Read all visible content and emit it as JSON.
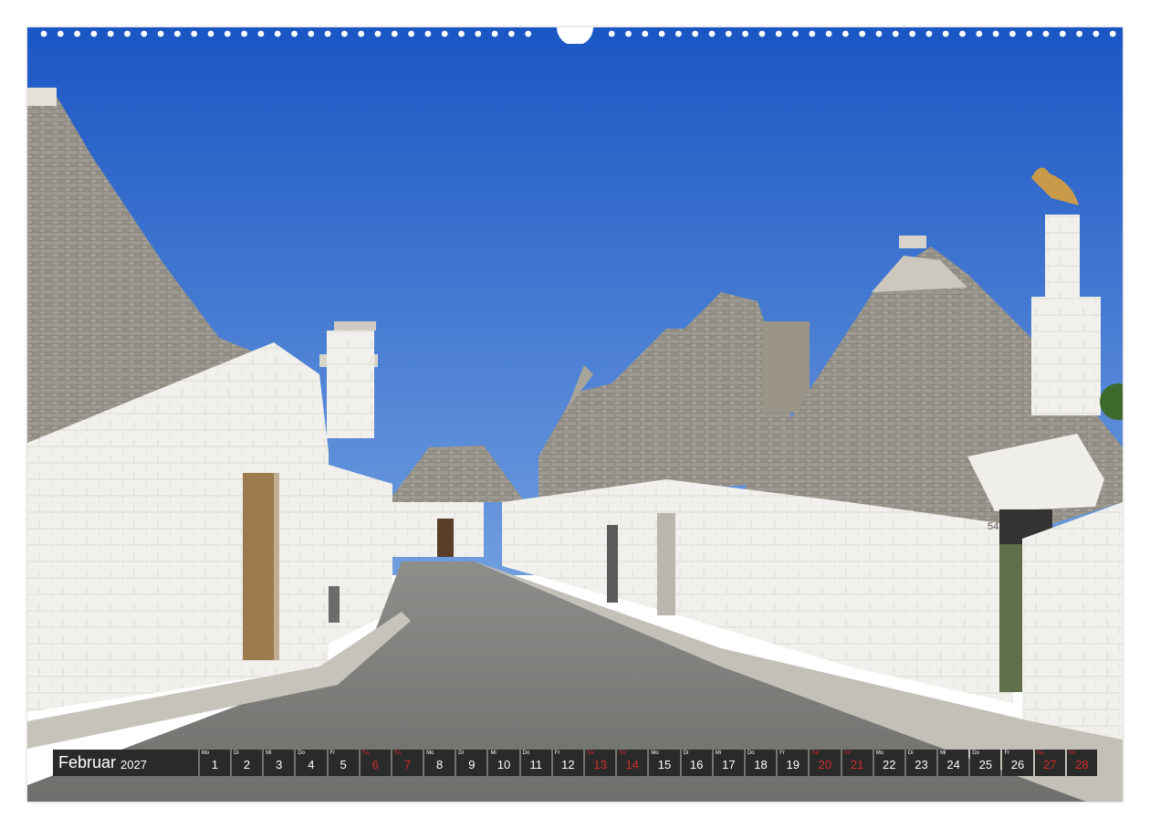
{
  "calendar": {
    "month": "Februar",
    "year": "2027",
    "days": [
      {
        "wd": "Mo",
        "d": "1",
        "weekend": false
      },
      {
        "wd": "Di",
        "d": "2",
        "weekend": false
      },
      {
        "wd": "Mi",
        "d": "3",
        "weekend": false
      },
      {
        "wd": "Do",
        "d": "4",
        "weekend": false
      },
      {
        "wd": "Fr",
        "d": "5",
        "weekend": false
      },
      {
        "wd": "Sa",
        "d": "6",
        "weekend": true
      },
      {
        "wd": "So",
        "d": "7",
        "weekend": true
      },
      {
        "wd": "Mo",
        "d": "8",
        "weekend": false
      },
      {
        "wd": "Di",
        "d": "9",
        "weekend": false
      },
      {
        "wd": "Mi",
        "d": "10",
        "weekend": false
      },
      {
        "wd": "Do",
        "d": "11",
        "weekend": false
      },
      {
        "wd": "Fr",
        "d": "12",
        "weekend": false
      },
      {
        "wd": "Sa",
        "d": "13",
        "weekend": true
      },
      {
        "wd": "So",
        "d": "14",
        "weekend": true
      },
      {
        "wd": "Mo",
        "d": "15",
        "weekend": false
      },
      {
        "wd": "Di",
        "d": "16",
        "weekend": false
      },
      {
        "wd": "Mi",
        "d": "17",
        "weekend": false
      },
      {
        "wd": "Do",
        "d": "18",
        "weekend": false
      },
      {
        "wd": "Fr",
        "d": "19",
        "weekend": false
      },
      {
        "wd": "Sa",
        "d": "20",
        "weekend": true
      },
      {
        "wd": "So",
        "d": "21",
        "weekend": true
      },
      {
        "wd": "Mo",
        "d": "22",
        "weekend": false
      },
      {
        "wd": "Di",
        "d": "23",
        "weekend": false
      },
      {
        "wd": "Mi",
        "d": "24",
        "weekend": false
      },
      {
        "wd": "Do",
        "d": "25",
        "weekend": false
      },
      {
        "wd": "Fr",
        "d": "26",
        "weekend": false
      },
      {
        "wd": "Sa",
        "d": "27",
        "weekend": true
      },
      {
        "wd": "So",
        "d": "28",
        "weekend": true
      }
    ]
  },
  "house_number": "54",
  "colors": {
    "sky_top": "#1f5cc7",
    "sky_bottom": "#6d9be0",
    "weekend": "#d42a2a",
    "bar": "#2a2a2a"
  }
}
